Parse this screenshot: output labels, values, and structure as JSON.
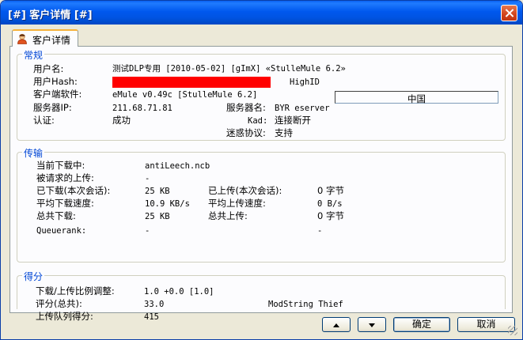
{
  "window": {
    "title": "[#] 客户详情 [#]"
  },
  "tab": {
    "label": "客户详情",
    "icon": "user-icon"
  },
  "general": {
    "title": "常规",
    "username_label": "用户名:",
    "username_value": "测试DLP专用 [2010-05-02] [gImX] «StulleMule 6.2»",
    "userhash_label": "用户Hash:",
    "highid": "HighID",
    "client_label": "客户端软件:",
    "client_value": "eMule v0.49c [StulleMule 6.2]",
    "country": "中国",
    "server_ip_label": "服务器IP:",
    "server_ip_value": "211.68.71.81",
    "server_name_label": "服务器名:",
    "server_name_value": "BYR eserver",
    "auth_label": "认证:",
    "auth_value": "成功",
    "kad_label": "Kad:",
    "kad_value": "连接断开",
    "obfuscation_label": "迷惑协议:",
    "obfuscation_value": "支持"
  },
  "transfer": {
    "title": "传输",
    "cur_download_label": "当前下载中:",
    "cur_download_value": "antiLeech.ncb",
    "req_upload_label": "被请求的上传:",
    "req_upload_value": "-",
    "downloaded_session_label": "已下载(本次会话):",
    "downloaded_session_value": "25 KB",
    "uploaded_session_label": "已上传(本次会话):",
    "uploaded_session_value": "0 字节",
    "avg_down_label": "平均下载速度:",
    "avg_down_value": "10.9 KB/s",
    "avg_up_label": "平均上传速度:",
    "avg_up_value": "0 B/s",
    "total_down_label": "总共下载:",
    "total_down_value": "25 KB",
    "total_up_label": "总共上传:",
    "total_up_value": "0 字节",
    "queuerank_label": "Queuerank:",
    "queuerank_value": "-",
    "queuerank_extra": "-"
  },
  "score": {
    "title": "得分",
    "ratio_label": "下载/上传比例调整:",
    "ratio_value": "1.0 +0.0 [1.0]",
    "rating_label": "评分(总共):",
    "rating_value": "33.0",
    "modstring": "ModString Thief",
    "queue_score_label": "上传队列得分:",
    "queue_score_value": "415"
  },
  "buttons": {
    "up_icon": "arrow-up-icon",
    "down_icon": "arrow-down-icon",
    "ok": "确定",
    "cancel": "取消"
  },
  "colors": {
    "titlebar": "#0054e3",
    "group_title": "#0046d5",
    "hash_redaction": "#ff0000"
  }
}
